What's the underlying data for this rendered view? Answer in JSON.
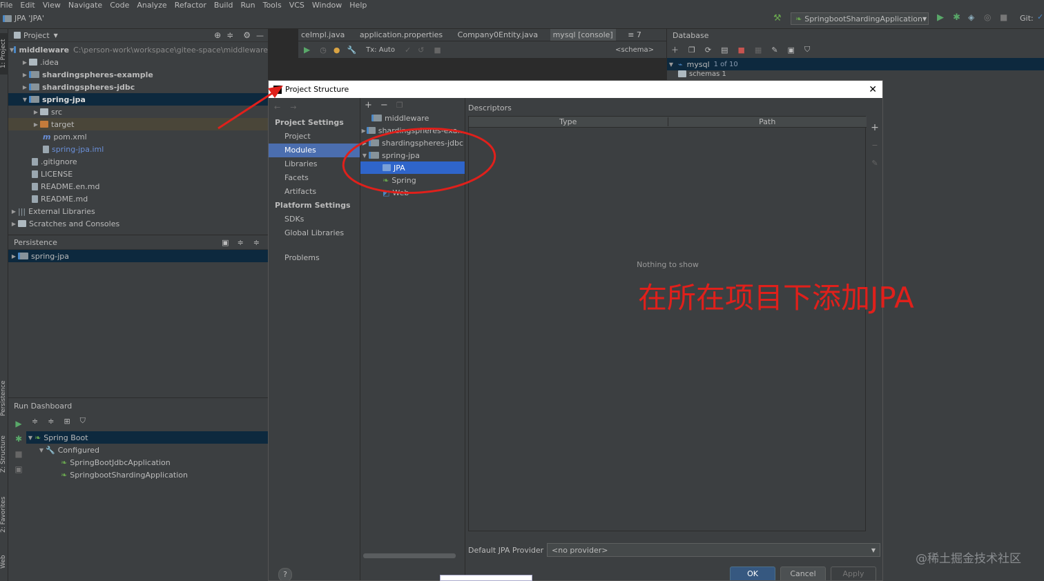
{
  "menu": [
    "File",
    "Edit",
    "View",
    "Navigate",
    "Code",
    "Analyze",
    "Refactor",
    "Build",
    "Run",
    "Tools",
    "VCS",
    "Window",
    "Help"
  ],
  "navbar": {
    "breadcrumb": "JPA 'JPA'",
    "run_config": "SpringbootShardingApplication",
    "git_label": "Git:"
  },
  "left_strip": {
    "project_tab": "1: Project",
    "persistence_tab": "Persistence",
    "structure_tab": "Z: Structure",
    "favorites_tab": "2: Favorites",
    "web_tab": "Web"
  },
  "project": {
    "header": "Project",
    "root_name": "middleware",
    "root_path": "C:\\person-work\\workspace\\gitee-space\\middleware",
    "items": [
      {
        "name": ".idea"
      },
      {
        "name": "shardingspheres-example"
      },
      {
        "name": "shardingspheres-jdbc"
      },
      {
        "name": "spring-jpa"
      },
      {
        "name": "src"
      },
      {
        "name": "target"
      },
      {
        "name": "pom.xml"
      },
      {
        "name": "spring-jpa.iml"
      },
      {
        "name": ".gitignore"
      },
      {
        "name": "LICENSE"
      },
      {
        "name": "README.en.md"
      },
      {
        "name": "README.md"
      },
      {
        "name": "External Libraries"
      },
      {
        "name": "Scratches and Consoles"
      }
    ]
  },
  "persistence": {
    "header": "Persistence",
    "item": "spring-jpa"
  },
  "editor_tabs": [
    "ceImpl.java",
    "application.properties",
    "Company0Entity.java",
    "mysql [console]",
    "≡ 7"
  ],
  "editor_toolbar": {
    "tx": "Tx: Auto",
    "schema": "<schema>"
  },
  "database": {
    "header": "Database",
    "conn_name": "mysql",
    "conn_count": "1 of 10",
    "schemas": "schemas 1"
  },
  "run_dashboard": {
    "header": "Run Dashboard",
    "spring_boot": "Spring Boot",
    "configured": "Configured",
    "app1": "SpringBootJdbcApplication",
    "app2": "SpringbootShardingApplication"
  },
  "dialog": {
    "title": "Project Structure",
    "project_settings": "Project Settings",
    "nav_project": [
      "Project",
      "Modules",
      "Libraries",
      "Facets",
      "Artifacts"
    ],
    "platform_settings": "Platform Settings",
    "nav_platform": [
      "SDKs",
      "Global Libraries"
    ],
    "problems": "Problems",
    "modules": [
      "middleware",
      "shardingspheres-exa...",
      "shardingspheres-jdbc",
      "spring-jpa",
      "JPA",
      "Spring",
      "Web"
    ],
    "descriptors_label": "Descriptors",
    "col_type": "Type",
    "col_path": "Path",
    "empty": "Nothing to show",
    "provider_label": "Default JPA Provider",
    "provider_value": "<no provider>",
    "ok": "OK",
    "cancel": "Cancel",
    "apply": "Apply",
    "help": "?"
  },
  "annotation": {
    "text": "在所在项目下添加JPA",
    "color": "#e0201b"
  },
  "watermark": "@稀土掘金技术社区",
  "colors": {
    "selection": "#4b6eaf",
    "tree_sel": "#0d293e",
    "panel": "#3c3f41",
    "editor": "#2b2b2b"
  }
}
